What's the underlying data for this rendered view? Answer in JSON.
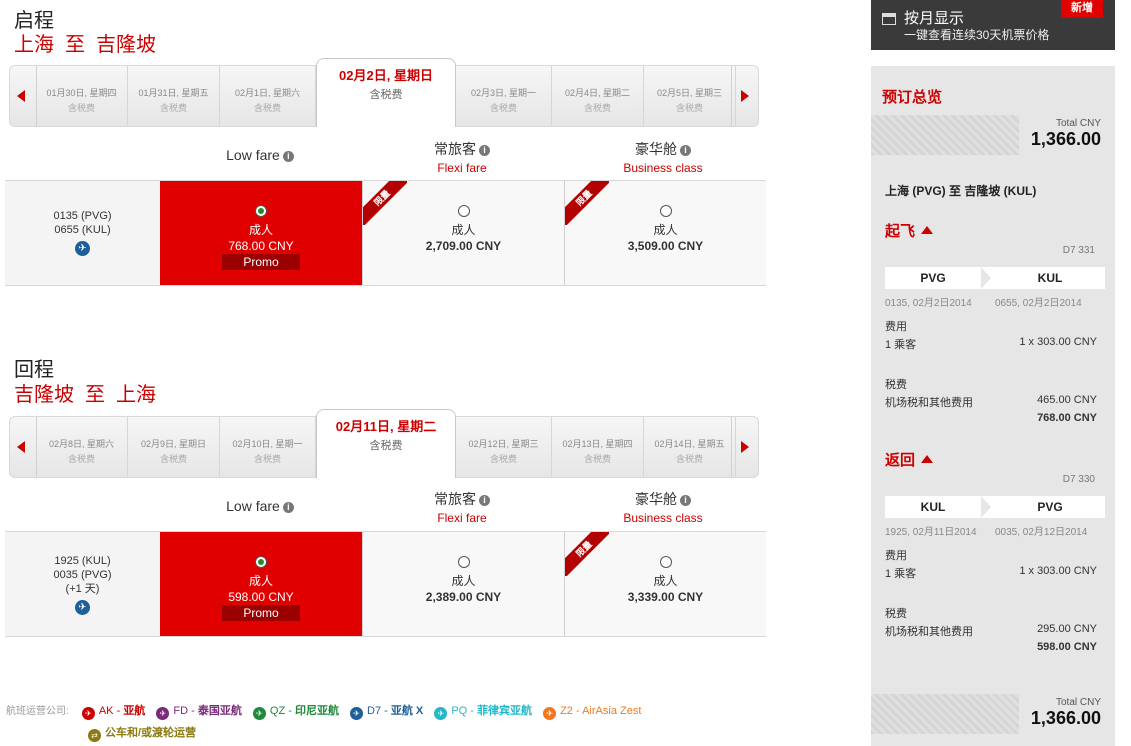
{
  "depart": {
    "title": "启程",
    "route": "上海 至 吉隆坡",
    "dates": [
      {
        "label": "01月30日, 星期四",
        "tax": "含税费"
      },
      {
        "label": "01月31日, 星期五",
        "tax": "含税费"
      },
      {
        "label": "02月1日, 星期六",
        "tax": "含税费"
      },
      {
        "label": "02月3日, 星期一",
        "tax": "含税费"
      },
      {
        "label": "02月4日, 星期二",
        "tax": "含税费"
      },
      {
        "label": "02月5日, 星期三",
        "tax": "含税费"
      }
    ],
    "selected_date": {
      "label": "02月2日, 星期日",
      "tax": "含税费"
    },
    "flight": {
      "dep": "0135 (PVG)",
      "arr": "0655 (KUL)"
    },
    "low": {
      "who": "成人",
      "price": "768.00 CNY",
      "promo": "Promo"
    },
    "flexi": {
      "who": "成人",
      "price": "2,709.00 CNY",
      "ribbon": "限量"
    },
    "business": {
      "who": "成人",
      "price": "3,509.00 CNY",
      "ribbon": "限量"
    }
  },
  "return": {
    "title": "回程",
    "route": "吉隆坡 至 上海",
    "dates": [
      {
        "label": "02月8日, 星期六",
        "tax": "含税费"
      },
      {
        "label": "02月9日, 星期日",
        "tax": "含税费"
      },
      {
        "label": "02月10日, 星期一",
        "tax": "含税费"
      },
      {
        "label": "02月12日, 星期三",
        "tax": "含税费"
      },
      {
        "label": "02月13日, 星期四",
        "tax": "含税费"
      },
      {
        "label": "02月14日, 星期五",
        "tax": "含税费"
      }
    ],
    "selected_date": {
      "label": "02月11日, 星期二",
      "tax": "含税费"
    },
    "flight": {
      "dep": "1925 (KUL)",
      "arr": "0035 (PVG)",
      "next_day": "(+1 天)"
    },
    "low": {
      "who": "成人",
      "price": "598.00 CNY",
      "promo": "Promo"
    },
    "flexi": {
      "who": "成人",
      "price": "2,389.00 CNY"
    },
    "business": {
      "who": "成人",
      "price": "3,339.00 CNY",
      "ribbon": "限量"
    }
  },
  "fare_headers": {
    "low": "Low fare",
    "flexi": "常旅客",
    "flexi_sub": "Flexi fare",
    "business": "豪华舱",
    "business_sub": "Business class",
    "info": "i"
  },
  "operators": {
    "label": "航班运营公司:",
    "items": [
      {
        "code": "AK",
        "name": "亚航",
        "color": "#cc0000"
      },
      {
        "code": "FD",
        "name": "泰国亚航",
        "color": "#7a2a7a"
      },
      {
        "code": "QZ",
        "name": "印尼亚航",
        "color": "#1e8a3a"
      },
      {
        "code": "D7",
        "name": "亚航 X",
        "color": "#1f5f97"
      },
      {
        "code": "PQ",
        "name": "菲律宾亚航",
        "color": "#22b8c8"
      },
      {
        "code": "Z2",
        "name": "AirAsia Zest",
        "color": "#f07820"
      }
    ],
    "bus": {
      "name": "公车和/或渡轮运营",
      "color": "#8a7a10"
    }
  },
  "monthly": {
    "title": "按月显示",
    "subtitle": "一键查看连续30天机票价格",
    "badge": "新增"
  },
  "summary": {
    "heading": "预订总览",
    "total_label": "Total CNY",
    "total": "1,366.00",
    "route": "上海 (PVG) 至 吉隆坡 (KUL)",
    "outbound": {
      "heading": "起飞",
      "flight_no": "D7 331",
      "from": "PVG",
      "to": "KUL",
      "from_time": "0135, 02月2日2014",
      "to_time": "0655, 02月2日2014",
      "fare_label": "费用",
      "pax": "1 乘客",
      "pax_fare": "1 x 303.00 CNY",
      "tax_label": "税费",
      "tax_item": "机场税和其他费用",
      "tax_amount": "465.00 CNY",
      "subtotal": "768.00 CNY"
    },
    "inbound": {
      "heading": "返回",
      "flight_no": "D7 330",
      "from": "KUL",
      "to": "PVG",
      "from_time": "1925, 02月11日2014",
      "to_time": "0035, 02月12日2014",
      "fare_label": "费用",
      "pax": "1 乘客",
      "pax_fare": "1 x 303.00 CNY",
      "tax_label": "税费",
      "tax_item": "机场税和其他费用",
      "tax_amount": "295.00 CNY",
      "subtotal": "598.00 CNY"
    },
    "bottom_total_label": "Total CNY",
    "bottom_total": "1,366.00"
  },
  "colors": {
    "brand_red": "#cc0000",
    "promo_red": "#e00000",
    "dark_panel": "#3a3a3a"
  }
}
